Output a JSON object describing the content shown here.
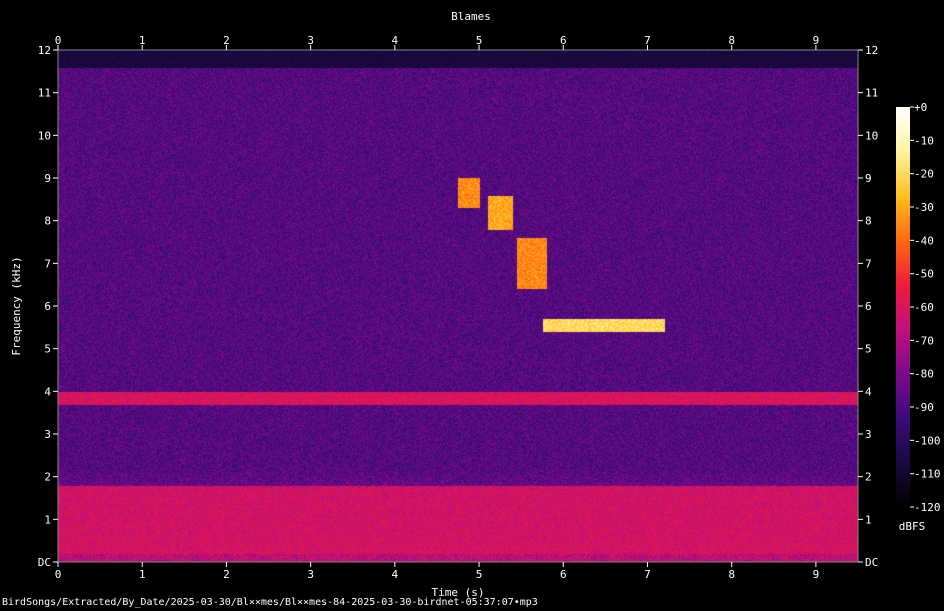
{
  "chart_data": {
    "type": "heatmap",
    "title": "Blames",
    "xlabel": "Time (s)",
    "ylabel": "Frequency (kHz)",
    "xlim": [
      0,
      9.5
    ],
    "ylim": [
      0,
      12
    ],
    "x_ticks": [
      "0",
      "1",
      "2",
      "3",
      "4",
      "5",
      "6",
      "7",
      "8",
      "9"
    ],
    "y_ticks": [
      "DC",
      "1",
      "2",
      "3",
      "4",
      "5",
      "6",
      "7",
      "8",
      "9",
      "10",
      "11",
      "12"
    ],
    "colorbar": {
      "label": "dBFS",
      "range": [
        -120,
        0
      ],
      "ticks": [
        "+0",
        "-10",
        "-20",
        "-30",
        "-40",
        "-50",
        "-60",
        "-70",
        "-80",
        "-90",
        "-100",
        "-110",
        "-120"
      ],
      "colors": [
        "#000000",
        "#1a0a40",
        "#3a0c78",
        "#7a0a8c",
        "#c0107a",
        "#f01a3c",
        "#ff6a10",
        "#ffc020",
        "#fff4a0",
        "#ffffff"
      ]
    },
    "energy_regions": [
      {
        "t": [
          0,
          9.5
        ],
        "f": [
          0.2,
          1.8
        ],
        "db": -62
      },
      {
        "t": [
          5.75,
          7.2
        ],
        "f": [
          5.4,
          5.7
        ],
        "db": -20
      },
      {
        "t": [
          4.75,
          5.0
        ],
        "f": [
          8.3,
          9.0
        ],
        "db": -35
      },
      {
        "t": [
          5.1,
          5.4
        ],
        "f": [
          7.8,
          8.6
        ],
        "db": -30
      },
      {
        "t": [
          5.45,
          5.8
        ],
        "f": [
          6.4,
          7.6
        ],
        "db": -35
      },
      {
        "t": [
          0,
          9.5
        ],
        "f": [
          3.7,
          4.0
        ],
        "db": -60
      }
    ]
  },
  "file_path": "BirdSongs/Extracted/By_Date/2025-03-30/Bl××mes/Bl××mes-84-2025-03-30-birdnet-05:37:07•mp3"
}
